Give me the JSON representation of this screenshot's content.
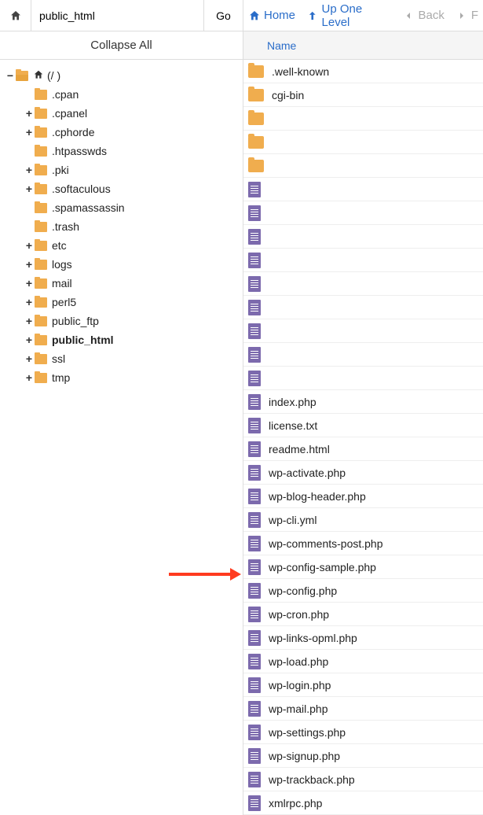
{
  "path_input": "public_html",
  "go_label": "Go",
  "collapse_all": "Collapse All",
  "root_label": "(/                              )",
  "nav": {
    "home": "Home",
    "up": "Up One Level",
    "back": "Back",
    "forward": "F"
  },
  "table": {
    "name_col": "Name"
  },
  "tree": [
    {
      "label": ".cpan",
      "indent": 2,
      "exp": ""
    },
    {
      "label": ".cpanel",
      "indent": 2,
      "exp": "+"
    },
    {
      "label": ".cphorde",
      "indent": 2,
      "exp": "+"
    },
    {
      "label": ".htpasswds",
      "indent": 2,
      "exp": ""
    },
    {
      "label": ".pki",
      "indent": 2,
      "exp": "+"
    },
    {
      "label": ".softaculous",
      "indent": 2,
      "exp": "+"
    },
    {
      "label": ".spamassassin",
      "indent": 2,
      "exp": ""
    },
    {
      "label": ".trash",
      "indent": 2,
      "exp": ""
    },
    {
      "label": "etc",
      "indent": 2,
      "exp": "+"
    },
    {
      "label": "logs",
      "indent": 2,
      "exp": "+"
    },
    {
      "label": "mail",
      "indent": 2,
      "exp": "+"
    },
    {
      "label": "perl5",
      "indent": 2,
      "exp": "+"
    },
    {
      "label": "public_ftp",
      "indent": 2,
      "exp": "+"
    },
    {
      "label": "public_html",
      "indent": 2,
      "exp": "+",
      "bold": true
    },
    {
      "label": "ssl",
      "indent": 2,
      "exp": "+"
    },
    {
      "label": "tmp",
      "indent": 2,
      "exp": "+"
    }
  ],
  "files": [
    {
      "name": ".well-known",
      "type": "folder"
    },
    {
      "name": "cgi-bin",
      "type": "folder"
    },
    {
      "name": "",
      "type": "folder",
      "obscured": true
    },
    {
      "name": "",
      "type": "folder",
      "obscured": true
    },
    {
      "name": "",
      "type": "folder",
      "obscured": true
    },
    {
      "name": "",
      "type": "doc",
      "obscured": true
    },
    {
      "name": "",
      "type": "doc",
      "obscured": true
    },
    {
      "name": "",
      "type": "doc",
      "obscured": true
    },
    {
      "name": "",
      "type": "doc",
      "obscured": true
    },
    {
      "name": "",
      "type": "doc",
      "obscured": true
    },
    {
      "name": "",
      "type": "doc",
      "obscured": true
    },
    {
      "name": "",
      "type": "doc",
      "obscured": true
    },
    {
      "name": "",
      "type": "doc",
      "obscured": true
    },
    {
      "name": "",
      "type": "doc",
      "obscured": true
    },
    {
      "name": "index.php",
      "type": "doc"
    },
    {
      "name": "license.txt",
      "type": "doc"
    },
    {
      "name": "readme.html",
      "type": "doc"
    },
    {
      "name": "wp-activate.php",
      "type": "doc"
    },
    {
      "name": "wp-blog-header.php",
      "type": "doc"
    },
    {
      "name": "wp-cli.yml",
      "type": "doc"
    },
    {
      "name": "wp-comments-post.php",
      "type": "doc"
    },
    {
      "name": "wp-config-sample.php",
      "type": "doc"
    },
    {
      "name": "wp-config.php",
      "type": "doc"
    },
    {
      "name": "wp-cron.php",
      "type": "doc"
    },
    {
      "name": "wp-links-opml.php",
      "type": "doc"
    },
    {
      "name": "wp-load.php",
      "type": "doc"
    },
    {
      "name": "wp-login.php",
      "type": "doc"
    },
    {
      "name": "wp-mail.php",
      "type": "doc"
    },
    {
      "name": "wp-settings.php",
      "type": "doc"
    },
    {
      "name": "wp-signup.php",
      "type": "doc"
    },
    {
      "name": "wp-trackback.php",
      "type": "doc"
    },
    {
      "name": "xmlrpc.php",
      "type": "doc"
    }
  ]
}
